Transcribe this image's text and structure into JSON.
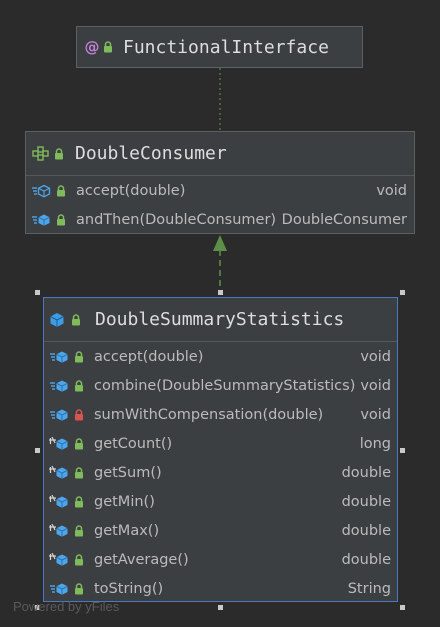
{
  "colors": {
    "background": "#2b2b2b",
    "node_fill": "#3c3f41",
    "selected_border": "#4a78c2",
    "public_lock": "#7fbb5a",
    "private_lock": "#d9534f",
    "method_icon": "#4ea6ea",
    "class_icon": "#3d9ce4",
    "annotation_icon": "#c07fd3",
    "inheritance_arrow": "#5d8f4a"
  },
  "nodes": {
    "functional_interface": {
      "title": "FunctionalInterface",
      "icon": "annotation-icon"
    },
    "double_consumer": {
      "title": "DoubleConsumer",
      "icon": "interface-icon",
      "members": [
        {
          "name": "accept(double)",
          "type": "void",
          "visibility": "public",
          "icon": "abstract-method-icon"
        },
        {
          "name": "andThen(DoubleConsumer)",
          "type": "DoubleConsumer",
          "visibility": "public",
          "icon": "method-icon"
        }
      ]
    },
    "double_summary_statistics": {
      "title": "DoubleSummaryStatistics",
      "icon": "class-icon",
      "members": [
        {
          "name": "accept(double)",
          "type": "void",
          "visibility": "public",
          "icon": "method-icon"
        },
        {
          "name": "combine(DoubleSummaryStatistics)",
          "type": "void",
          "visibility": "public",
          "icon": "method-icon"
        },
        {
          "name": "sumWithCompensation(double)",
          "type": "void",
          "visibility": "private",
          "icon": "method-icon"
        },
        {
          "name": "getCount()",
          "type": "long",
          "visibility": "public",
          "icon": "final-method-icon"
        },
        {
          "name": "getSum()",
          "type": "double",
          "visibility": "public",
          "icon": "final-method-icon"
        },
        {
          "name": "getMin()",
          "type": "double",
          "visibility": "public",
          "icon": "final-method-icon"
        },
        {
          "name": "getMax()",
          "type": "double",
          "visibility": "public",
          "icon": "final-method-icon"
        },
        {
          "name": "getAverage()",
          "type": "double",
          "visibility": "public",
          "icon": "final-method-icon"
        },
        {
          "name": "toString()",
          "type": "String",
          "visibility": "public",
          "icon": "method-icon"
        }
      ]
    }
  },
  "footer": "Powered by yFiles"
}
